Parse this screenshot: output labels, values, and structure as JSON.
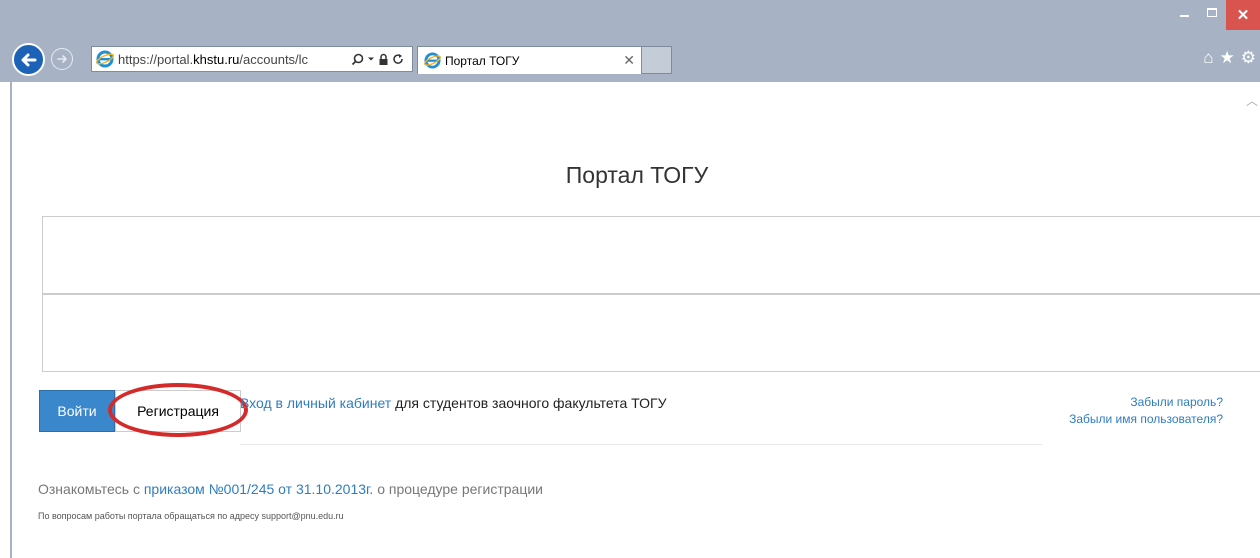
{
  "browser": {
    "url_prefix": "https://portal.",
    "url_domain": "khstu.ru",
    "url_path": "/accounts/lc",
    "tab_title": "Портал ТОГУ",
    "icons": [
      "back-arrow-icon",
      "forward-arrow-icon",
      "ie-logo-icon",
      "search-icon",
      "dropdown-icon",
      "lock-icon",
      "refresh-icon",
      "tab-close-icon",
      "home-icon",
      "star-icon",
      "gear-icon",
      "minimize-icon",
      "maximize-icon",
      "close-icon"
    ]
  },
  "page": {
    "title": "Портал ТОГУ",
    "username_value": "",
    "password_value": "",
    "login_button": "Войти",
    "register_button": "Регистрация",
    "cabinet_link": "Вход в личный кабинет",
    "cabinet_suffix": " для студентов заочного факультета ТОГУ",
    "forgot_password": "Забыли пароль?",
    "forgot_username": "Забыли имя пользователя?",
    "notice_prefix": "Ознакомьтесь с ",
    "notice_link": "приказом №001/245 от 31.10.2013г.",
    "notice_suffix": " о процедуре регистрации",
    "support_text": "По вопросам работы портала обращаться по адресу support@pnu.edu.ru"
  },
  "colors": {
    "chrome": "#a7b3c4",
    "link": "#2f7dc0",
    "primary_button": "#3a87cb",
    "highlight": "#d42a2a",
    "close_button": "#d9534f"
  }
}
